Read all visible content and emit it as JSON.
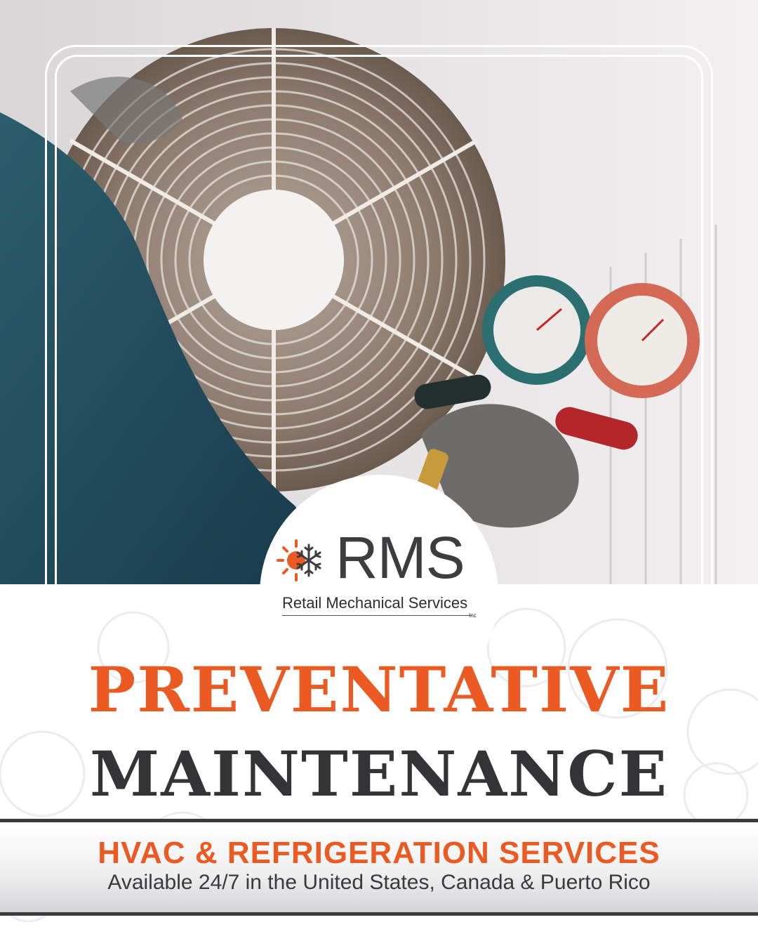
{
  "logo": {
    "letters": "RMS",
    "company_name": "Retail Mechanical Services",
    "suffix": "Inc"
  },
  "headline": {
    "line1": "PREVENTATIVE",
    "line2": "MAINTENANCE"
  },
  "banner": {
    "title": "HVAC & REFRIGERATION SERVICES",
    "subtitle": "Available 24/7 in the United States, Canada & Puerto Rico"
  },
  "colors": {
    "accent_orange": "#ea5a22",
    "dark_gray": "#343436",
    "white": "#ffffff"
  },
  "icons": [
    "sun-icon",
    "snowflake-icon",
    "fan-grille-icon",
    "pressure-gauge-icon"
  ]
}
